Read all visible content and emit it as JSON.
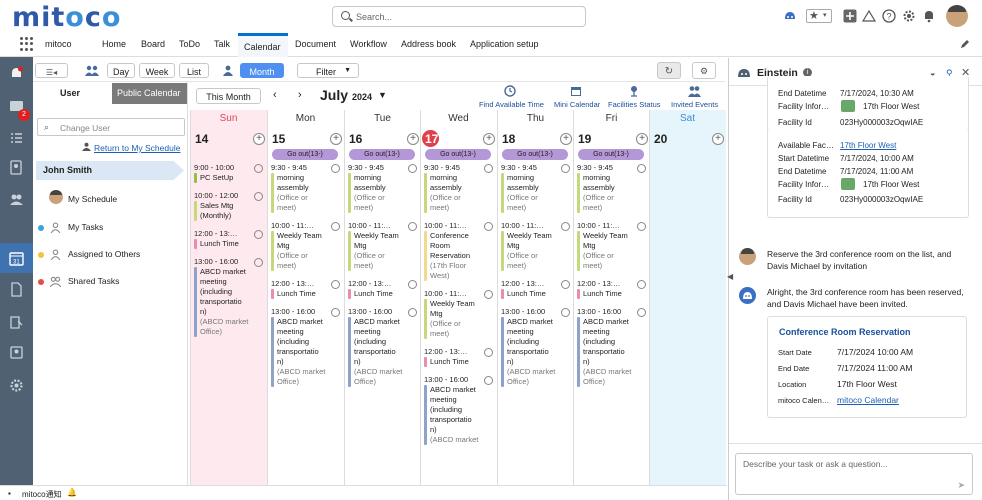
{
  "app": {
    "logo": "mitoco",
    "app_name": "mitoco"
  },
  "search": {
    "placeholder": "Search..."
  },
  "nav": {
    "tabs": [
      "Home",
      "Board",
      "ToDo",
      "Talk",
      "Calendar",
      "Document",
      "Workflow",
      "Address book",
      "Application setup"
    ],
    "active": "Calendar"
  },
  "rail": {
    "notification_badge": "2"
  },
  "toolbar": {
    "views": [
      "Day",
      "Week",
      "List",
      "Month"
    ],
    "active_view": "Month",
    "filter": "Filter"
  },
  "left_panel": {
    "user_label": "User",
    "public_calendar": "Public Calendar",
    "change_user_placeholder": "Change User",
    "return_link": "Return to My Schedule",
    "selected_user": "John Smith",
    "items": [
      "My Schedule",
      "My Tasks",
      "Assigned to Others",
      "Shared Tasks"
    ],
    "item_colors": [
      "#f39a3b",
      "#3aa3e3",
      "#f3c43b",
      "#e24c4c"
    ]
  },
  "calendar": {
    "this_month": "This Month",
    "month": "July",
    "year": "2024",
    "actions": [
      "Find Available Time",
      "Mini Calendar",
      "Facilities Status",
      "Invited Events"
    ],
    "days": [
      {
        "name": "Sun",
        "num": "14"
      },
      {
        "name": "Mon",
        "num": "15"
      },
      {
        "name": "Tue",
        "num": "16"
      },
      {
        "name": "Wed",
        "num": "17"
      },
      {
        "name": "Thu",
        "num": "18"
      },
      {
        "name": "Fri",
        "num": "19"
      },
      {
        "name": "Sat",
        "num": "20"
      }
    ],
    "go_out": "Go out(13-)",
    "sun_events": [
      {
        "time": "9:00 - 10:00",
        "title": "PC SetUp",
        "loc": "",
        "color": "#8bc34a"
      },
      {
        "time": "10:00 - 12:00",
        "title": "Sales Mtg (Monthly)",
        "loc": "",
        "color": "#c3d97a"
      },
      {
        "time": "12:00 - 13:…",
        "title": "Lunch Time",
        "loc": "",
        "color": "#e98cb2"
      },
      {
        "time": "13:00 - 16:00",
        "title": "ABCD market meeting (including transportatio n)",
        "loc": "(ABCD market Office)",
        "color": "#8fa3c9"
      }
    ],
    "weekday_events": [
      {
        "time": "9:30 - 9:45",
        "title": "morning assembly",
        "loc": "(Office or meet)",
        "color": "#c3d97a"
      },
      {
        "time": "10:00 - 11:…",
        "title": "Weekly Team Mtg",
        "loc": "(Office or meet)",
        "color": "#c3d97a"
      },
      {
        "time": "12:00 - 13:…",
        "title": "Lunch Time",
        "loc": "",
        "color": "#e98cb2"
      },
      {
        "time": "13:00 - 16:00",
        "title": "ABCD market meeting (including transportatio n)",
        "loc": "(ABCD market Office)",
        "color": "#8fa3c9"
      }
    ],
    "wed_events": [
      {
        "time": "9:30 - 9:45",
        "title": "morning assembly",
        "loc": "(Office or meet)",
        "color": "#c3d97a"
      },
      {
        "time": "10:00 - 11:…",
        "title": "Conference Room Reservation",
        "loc": "(17th Floor West)",
        "color": "#f3d98a"
      },
      {
        "time": "10:00 - 11:…",
        "title": "Weekly Team Mtg",
        "loc": "(Office or meet)",
        "color": "#c3d97a"
      },
      {
        "time": "12:00 - 13:…",
        "title": "Lunch Time",
        "loc": "",
        "color": "#e98cb2"
      },
      {
        "time": "13:00 - 16:00",
        "title": "ABCD market meeting (including transportatio n)",
        "loc": "(ABCD market",
        "color": "#8fa3c9"
      }
    ]
  },
  "einstein": {
    "title": "Einstein",
    "top_card": [
      {
        "k": "End Datetime",
        "v": "7/17/2024, 10:30 AM"
      },
      {
        "k": "Facility Infor…",
        "v": "17th Floor West"
      },
      {
        "k": "Facility Id",
        "v": "023Hy000003zOqwIAE"
      }
    ],
    "mid_card": [
      {
        "k": "Available Fac…",
        "v": "17th Floor West"
      },
      {
        "k": "Start Datetime",
        "v": "7/17/2024, 10:00 AM"
      },
      {
        "k": "End Datetime",
        "v": "7/17/2024, 11:00 AM"
      },
      {
        "k": "Facility Infor…",
        "v": "17th Floor West"
      },
      {
        "k": "Facility Id",
        "v": "023Hy000003zOqwIAE"
      }
    ],
    "user_msg": "Reserve the 3rd conference room on the list, and Davis Michael by invitation",
    "bot_msg": "Alright, the 3rd conference room has been reserved, and Davis Michael have been invited.",
    "result_card": {
      "title": "Conference Room Reservation",
      "rows": [
        {
          "k": "Start Date",
          "v": "7/17/2024 10:00 AM"
        },
        {
          "k": "End Date",
          "v": "7/17/2024 11:00 AM"
        },
        {
          "k": "Location",
          "v": "17th Floor West"
        },
        {
          "k": "mitoco Calen…",
          "v": "mitoco Calendar"
        }
      ]
    },
    "input_placeholder": "Describe your task or ask a question..."
  },
  "footer": {
    "label": "mitoco通知"
  }
}
